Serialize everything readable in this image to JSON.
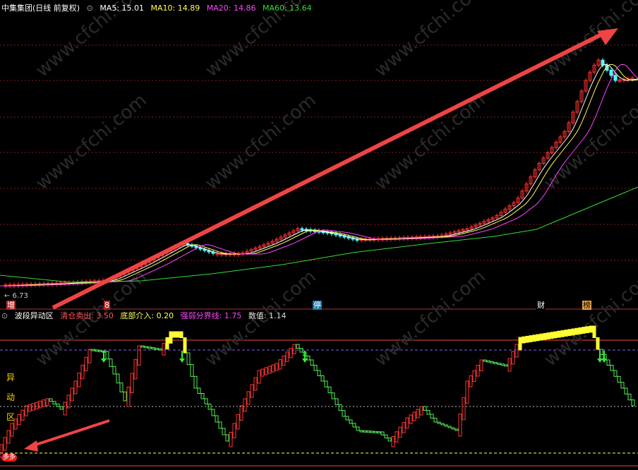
{
  "main_header": {
    "title": "中集集团(日线 前复权)",
    "ma5_label": "MA5: 15.01",
    "ma10_label": "MA10: 14.89",
    "ma20_label": "MA20: 14.86",
    "ma60_label": "MA60: 13.64"
  },
  "indicator_header": {
    "name": "波段异动区",
    "sell_label": "清仓卖出: 3.50",
    "buy_label": "底部介入: 0.20",
    "line_label": "强弱分界线: 1.75",
    "value_label": "数值: 1.14"
  },
  "low_price_label": "← 6.73",
  "signals": [
    "增",
    "8",
    "停",
    "财",
    "榜"
  ],
  "vertical_label": [
    "异",
    "动",
    "区"
  ],
  "bottom_badge": "多多",
  "colors": {
    "up": "#ff3333",
    "down": "#54ffff",
    "ma5": "#ffffff",
    "ma10": "#ffff55",
    "ma20": "#ff44ff",
    "ma60": "#33dd33",
    "grid": "#8a1a1a",
    "arrow": "#ee4444",
    "watermark": "cfchi.com"
  },
  "chart_data": {
    "type": "candlestick",
    "title": "中集集团(日线 前复权)",
    "series": [
      {
        "name": "MA5",
        "last": 15.01
      },
      {
        "name": "MA10",
        "last": 14.89
      },
      {
        "name": "MA20",
        "last": 14.86
      },
      {
        "name": "MA60",
        "last": 13.64
      }
    ],
    "low_marker": 6.73,
    "indicator": {
      "name": "波段异动区",
      "清仓卖出": 3.5,
      "底部介入": 0.2,
      "强弱分界线": 1.75,
      "数值": 1.14
    }
  }
}
